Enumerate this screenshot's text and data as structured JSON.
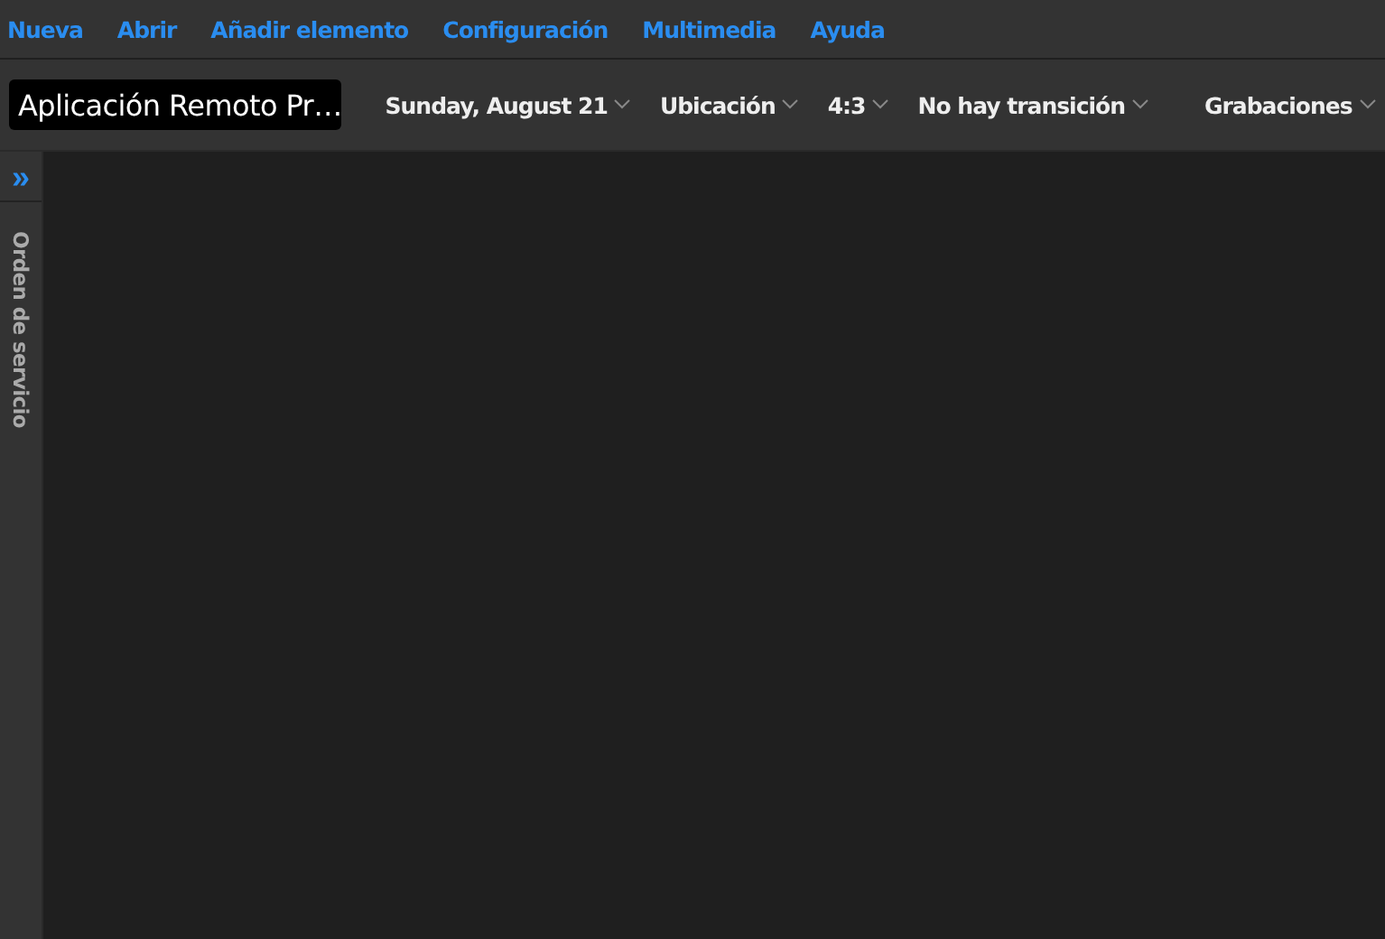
{
  "menu": [
    "Nueva",
    "Abrir",
    "Añadir elemento",
    "Configuración",
    "Multimedia",
    "Ayuda"
  ],
  "toolbar": {
    "title": "Aplicación Remoto Pr…",
    "dropdowns": [
      "Sunday, August 21",
      "Ubicación",
      "4:3",
      "No hay transición"
    ],
    "right_dropdown": "Grabaciones"
  },
  "sidebar": {
    "toggle": "»",
    "label": "Orden de servicio"
  }
}
